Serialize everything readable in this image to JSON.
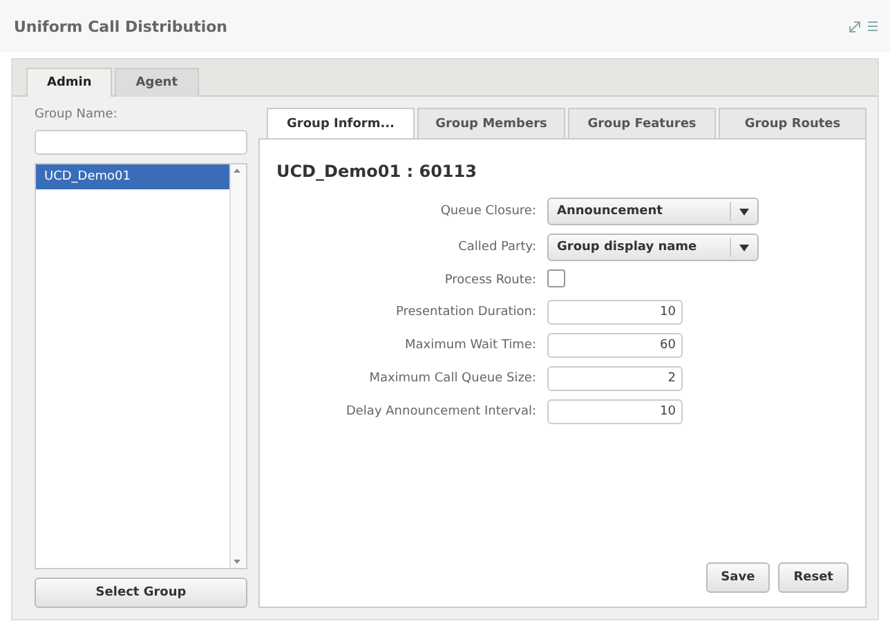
{
  "window": {
    "title": "Uniform Call Distribution"
  },
  "outer_tabs": [
    {
      "label": "Admin",
      "selected": true
    },
    {
      "label": "Agent",
      "selected": false
    }
  ],
  "group_panel": {
    "label": "Group Name:",
    "items": [
      {
        "label": "UCD_Demo01",
        "selected": true
      }
    ],
    "button": "Select Group"
  },
  "inner_tabs": [
    {
      "label": "Group Inform...",
      "selected": true
    },
    {
      "label": "Group Members",
      "selected": false
    },
    {
      "label": "Group Features",
      "selected": false
    },
    {
      "label": "Group Routes",
      "selected": false
    }
  ],
  "heading": "UCD_Demo01 : 60113",
  "fields": [
    {
      "kind": "select",
      "label": "Queue Closure:",
      "value": "Announcement"
    },
    {
      "kind": "select",
      "label": "Called Party:",
      "value": "Group display name"
    },
    {
      "kind": "checkbox",
      "label": "Process Route:",
      "checked": false
    },
    {
      "kind": "number",
      "label": "Presentation Duration:",
      "value": "10"
    },
    {
      "kind": "number",
      "label": "Maximum Wait Time:",
      "value": "60"
    },
    {
      "kind": "number",
      "label": "Maximum Call Queue Size:",
      "value": "2"
    },
    {
      "kind": "number",
      "label": "Delay Announcement Interval:",
      "value": "10"
    }
  ],
  "buttons": [
    "Save",
    "Reset"
  ]
}
